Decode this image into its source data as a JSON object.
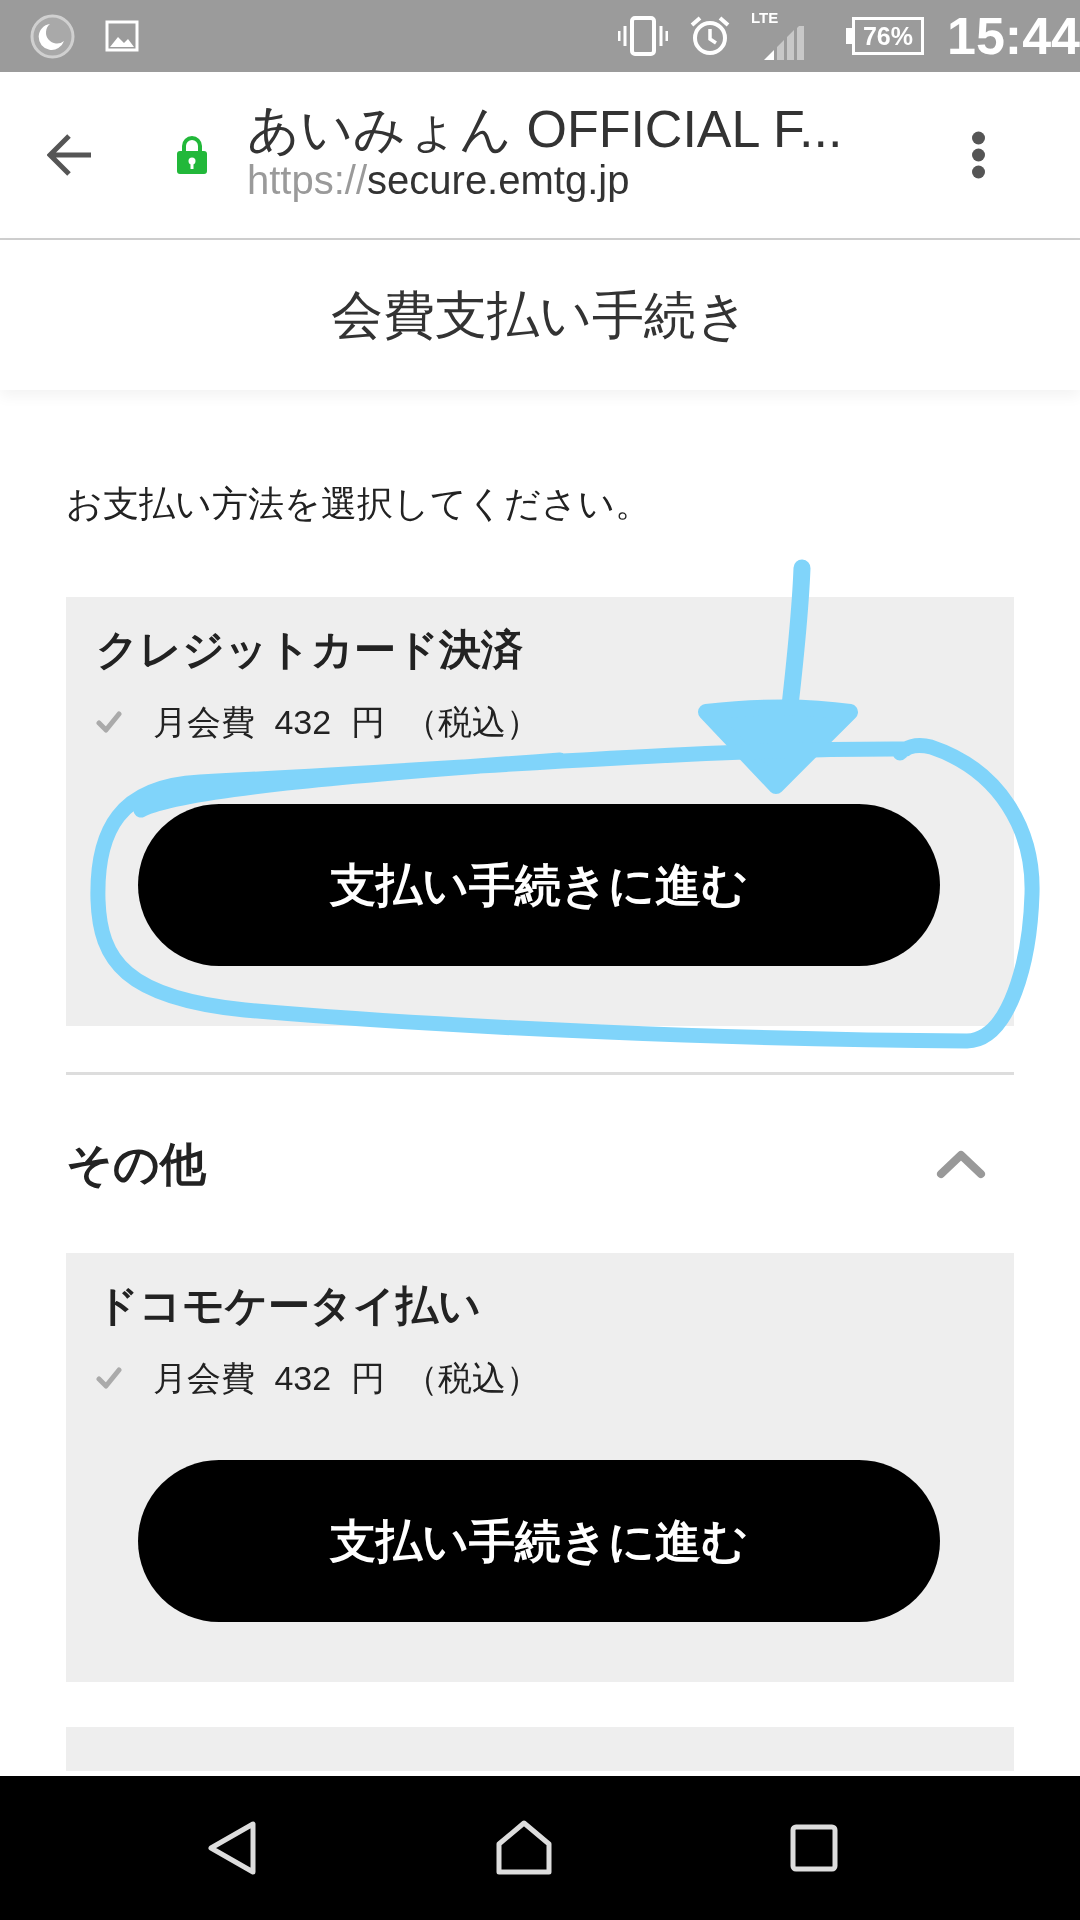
{
  "status_bar": {
    "network_type": "LTE",
    "battery": "76%",
    "time": "15:44"
  },
  "browser_bar": {
    "page_title": "あいみょん OFFICIAL F...",
    "url": {
      "scheme": "https://",
      "host": "secure.emtg.jp"
    }
  },
  "page_header": {
    "title": "会費支払い手続き"
  },
  "instruction": "お支払い方法を選択してください。",
  "payment_methods": [
    {
      "kind": "full",
      "title": "クレジットカード決済",
      "fee": "月会費 432 円 （税込）",
      "button": "支払い手続きに進む"
    }
  ],
  "other_section": {
    "title": "その他",
    "expanded": true,
    "methods": [
      {
        "kind": "full",
        "title": "ドコモケータイ払い",
        "fee": "月会費 432 円 （税込）",
        "button": "支払い手続きに進む"
      },
      {
        "kind": "partial"
      }
    ]
  }
}
